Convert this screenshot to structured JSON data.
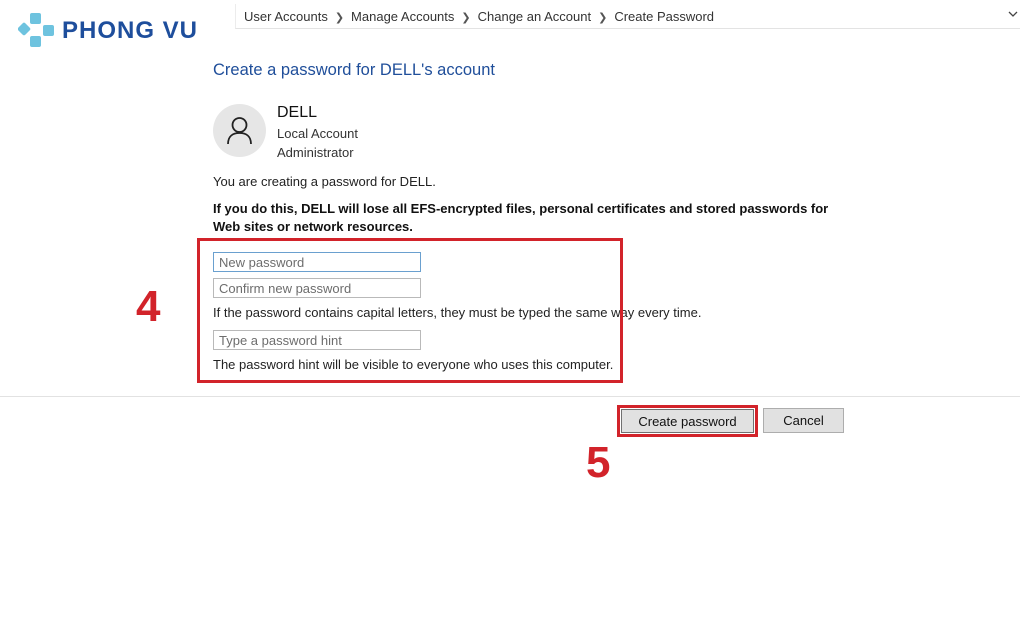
{
  "logo": {
    "text": "PHONG VU",
    "colors": {
      "primary": "#1e4e9c",
      "accent": "#6ec3df"
    }
  },
  "addressbar": {
    "breadcrumbs": [
      "User Accounts",
      "Manage Accounts",
      "Change an Account",
      "Create Password"
    ],
    "dropdown_icon": "chevron-down-icon"
  },
  "page": {
    "title": "Create a password for DELL's account"
  },
  "account": {
    "avatar_icon": "user-icon",
    "name": "DELL",
    "type": "Local Account",
    "role": "Administrator"
  },
  "messages": {
    "info": "You are creating a password for DELL.",
    "warning": "If you do this, DELL will lose all EFS-encrypted files, personal certificates and stored passwords for Web sites or network resources.",
    "caps_note": "If the password contains capital letters, they must be typed the same way every time.",
    "hint_note": "The password hint will be visible to everyone who uses this computer."
  },
  "form": {
    "new_password": {
      "value": "",
      "placeholder": "New password"
    },
    "confirm_password": {
      "value": "",
      "placeholder": "Confirm new password"
    },
    "hint": {
      "value": "",
      "placeholder": "Type a password hint"
    }
  },
  "buttons": {
    "create": "Create password",
    "cancel": "Cancel"
  },
  "annotations": {
    "step_4": "4",
    "step_5": "5",
    "color": "#d2232a"
  }
}
